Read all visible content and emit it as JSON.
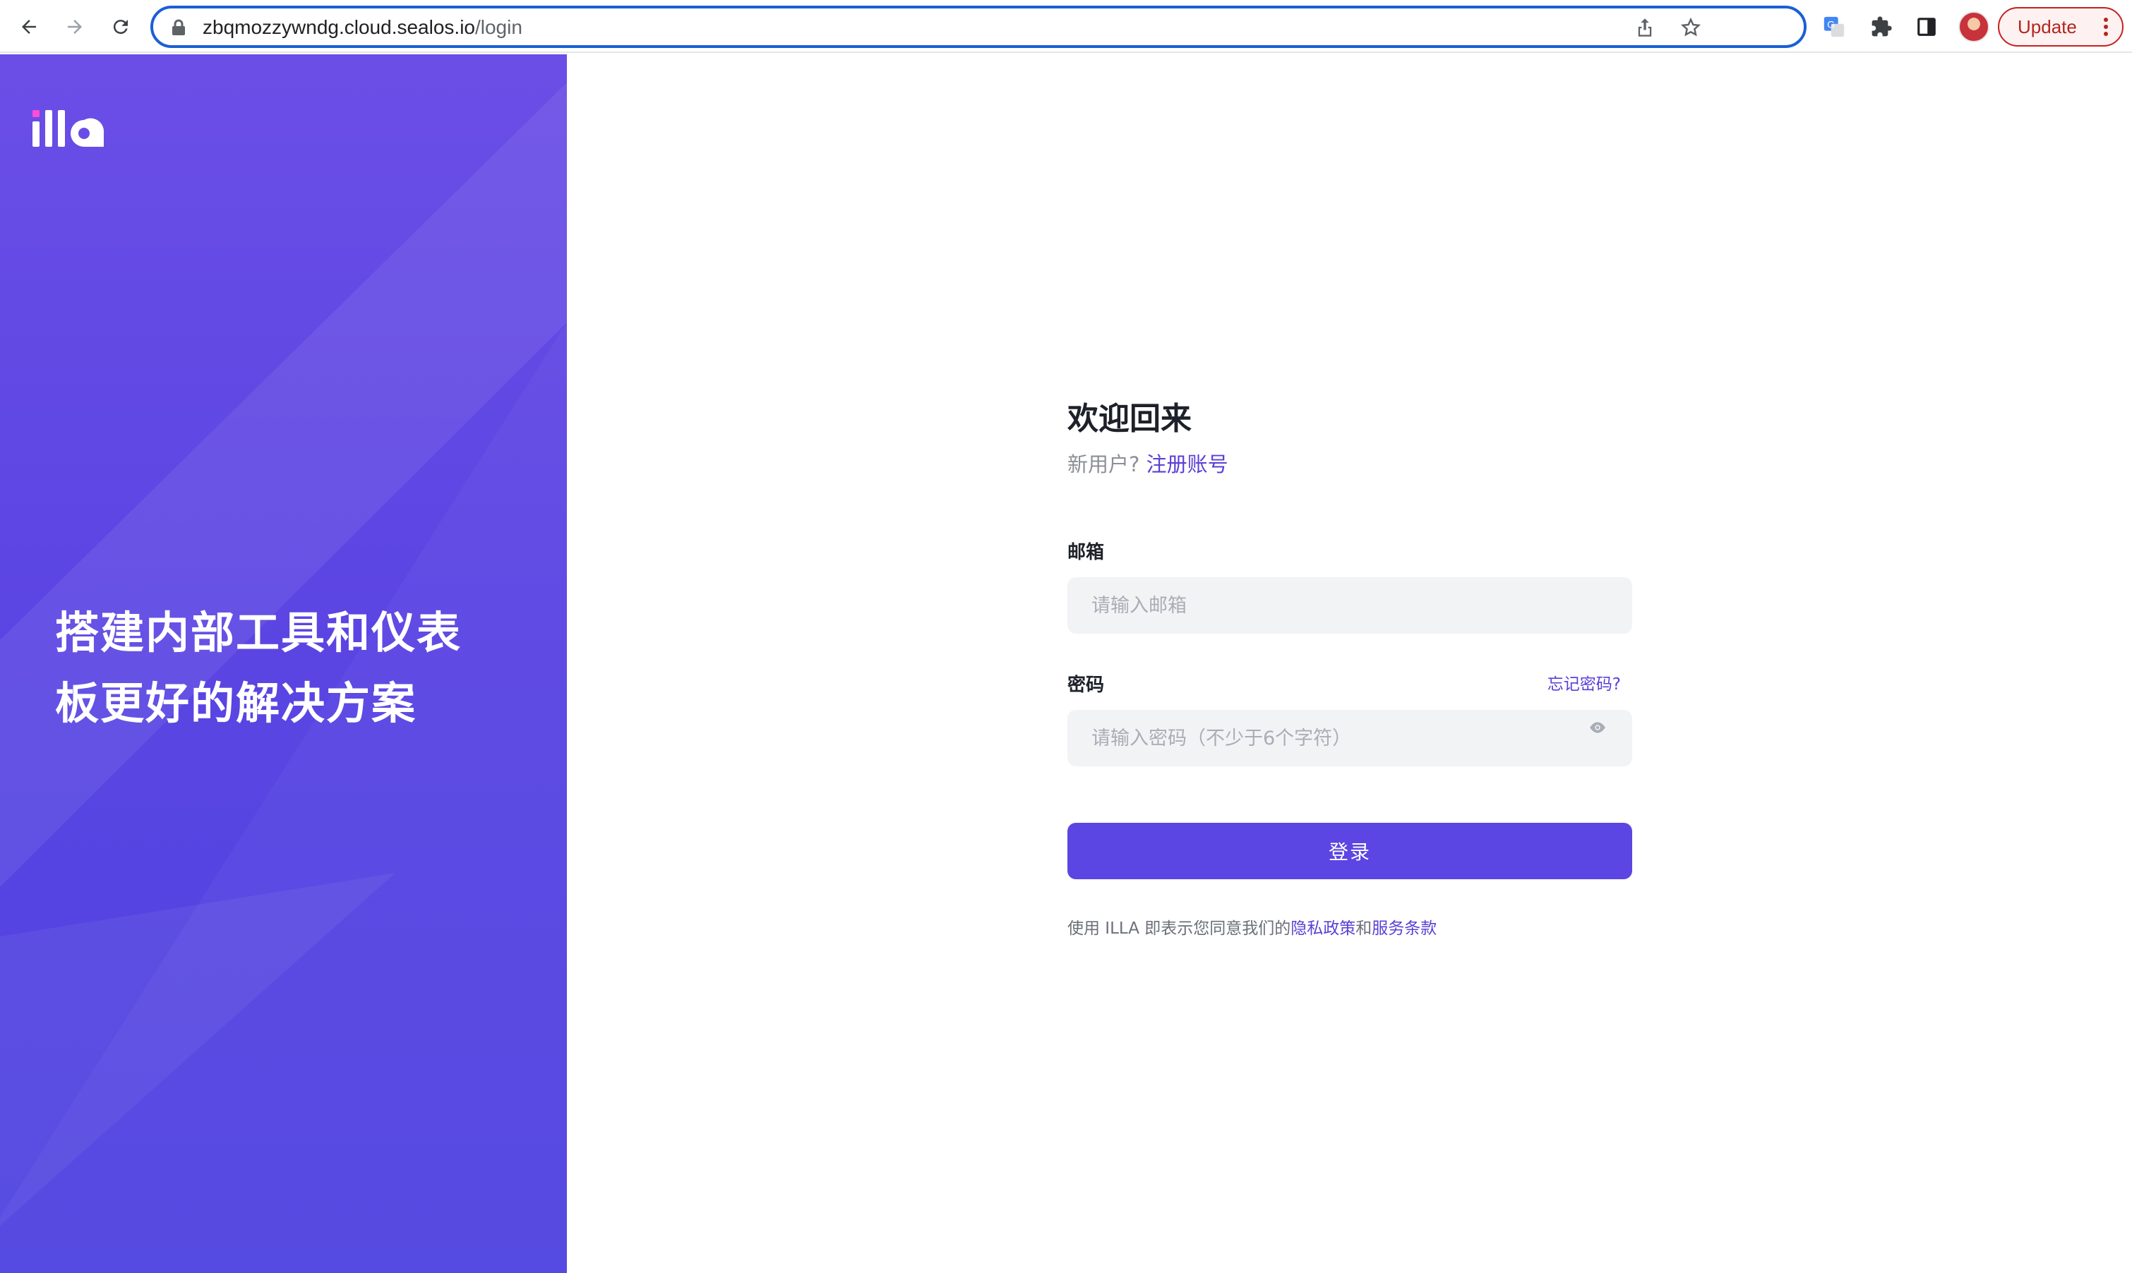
{
  "browser": {
    "url_host": "zbqmozzywndg.cloud.sealos.io",
    "url_path": "/login",
    "update_label": "Update",
    "icons": [
      "back-arrow-icon",
      "forward-arrow-icon",
      "reload-icon",
      "lock-icon",
      "share-icon",
      "star-icon",
      "translate-icon",
      "puzzle-icon",
      "side-panel-icon",
      "profile-avatar",
      "more-vert-icon"
    ]
  },
  "brand": {
    "logo_text": "illa",
    "tagline_line1": "搭建内部工具和仪表",
    "tagline_line2": "板更好的解决方案",
    "colors": {
      "primary": "#5b45e3",
      "link": "#5b3fd6"
    }
  },
  "login": {
    "title": "欢迎回来",
    "new_user_prefix": "新用户?",
    "register_link": "注册账号",
    "email_label": "邮箱",
    "email_placeholder": "请输入邮箱",
    "password_label": "密码",
    "forgot_link": "忘记密码?",
    "password_placeholder": "请输入密码（不少于6个字符）",
    "submit_label": "登录",
    "terms_prefix": "使用 ILLA 即表示您同意我们的",
    "privacy_link": "隐私政策",
    "terms_joiner": "和",
    "service_link": "服务条款"
  }
}
